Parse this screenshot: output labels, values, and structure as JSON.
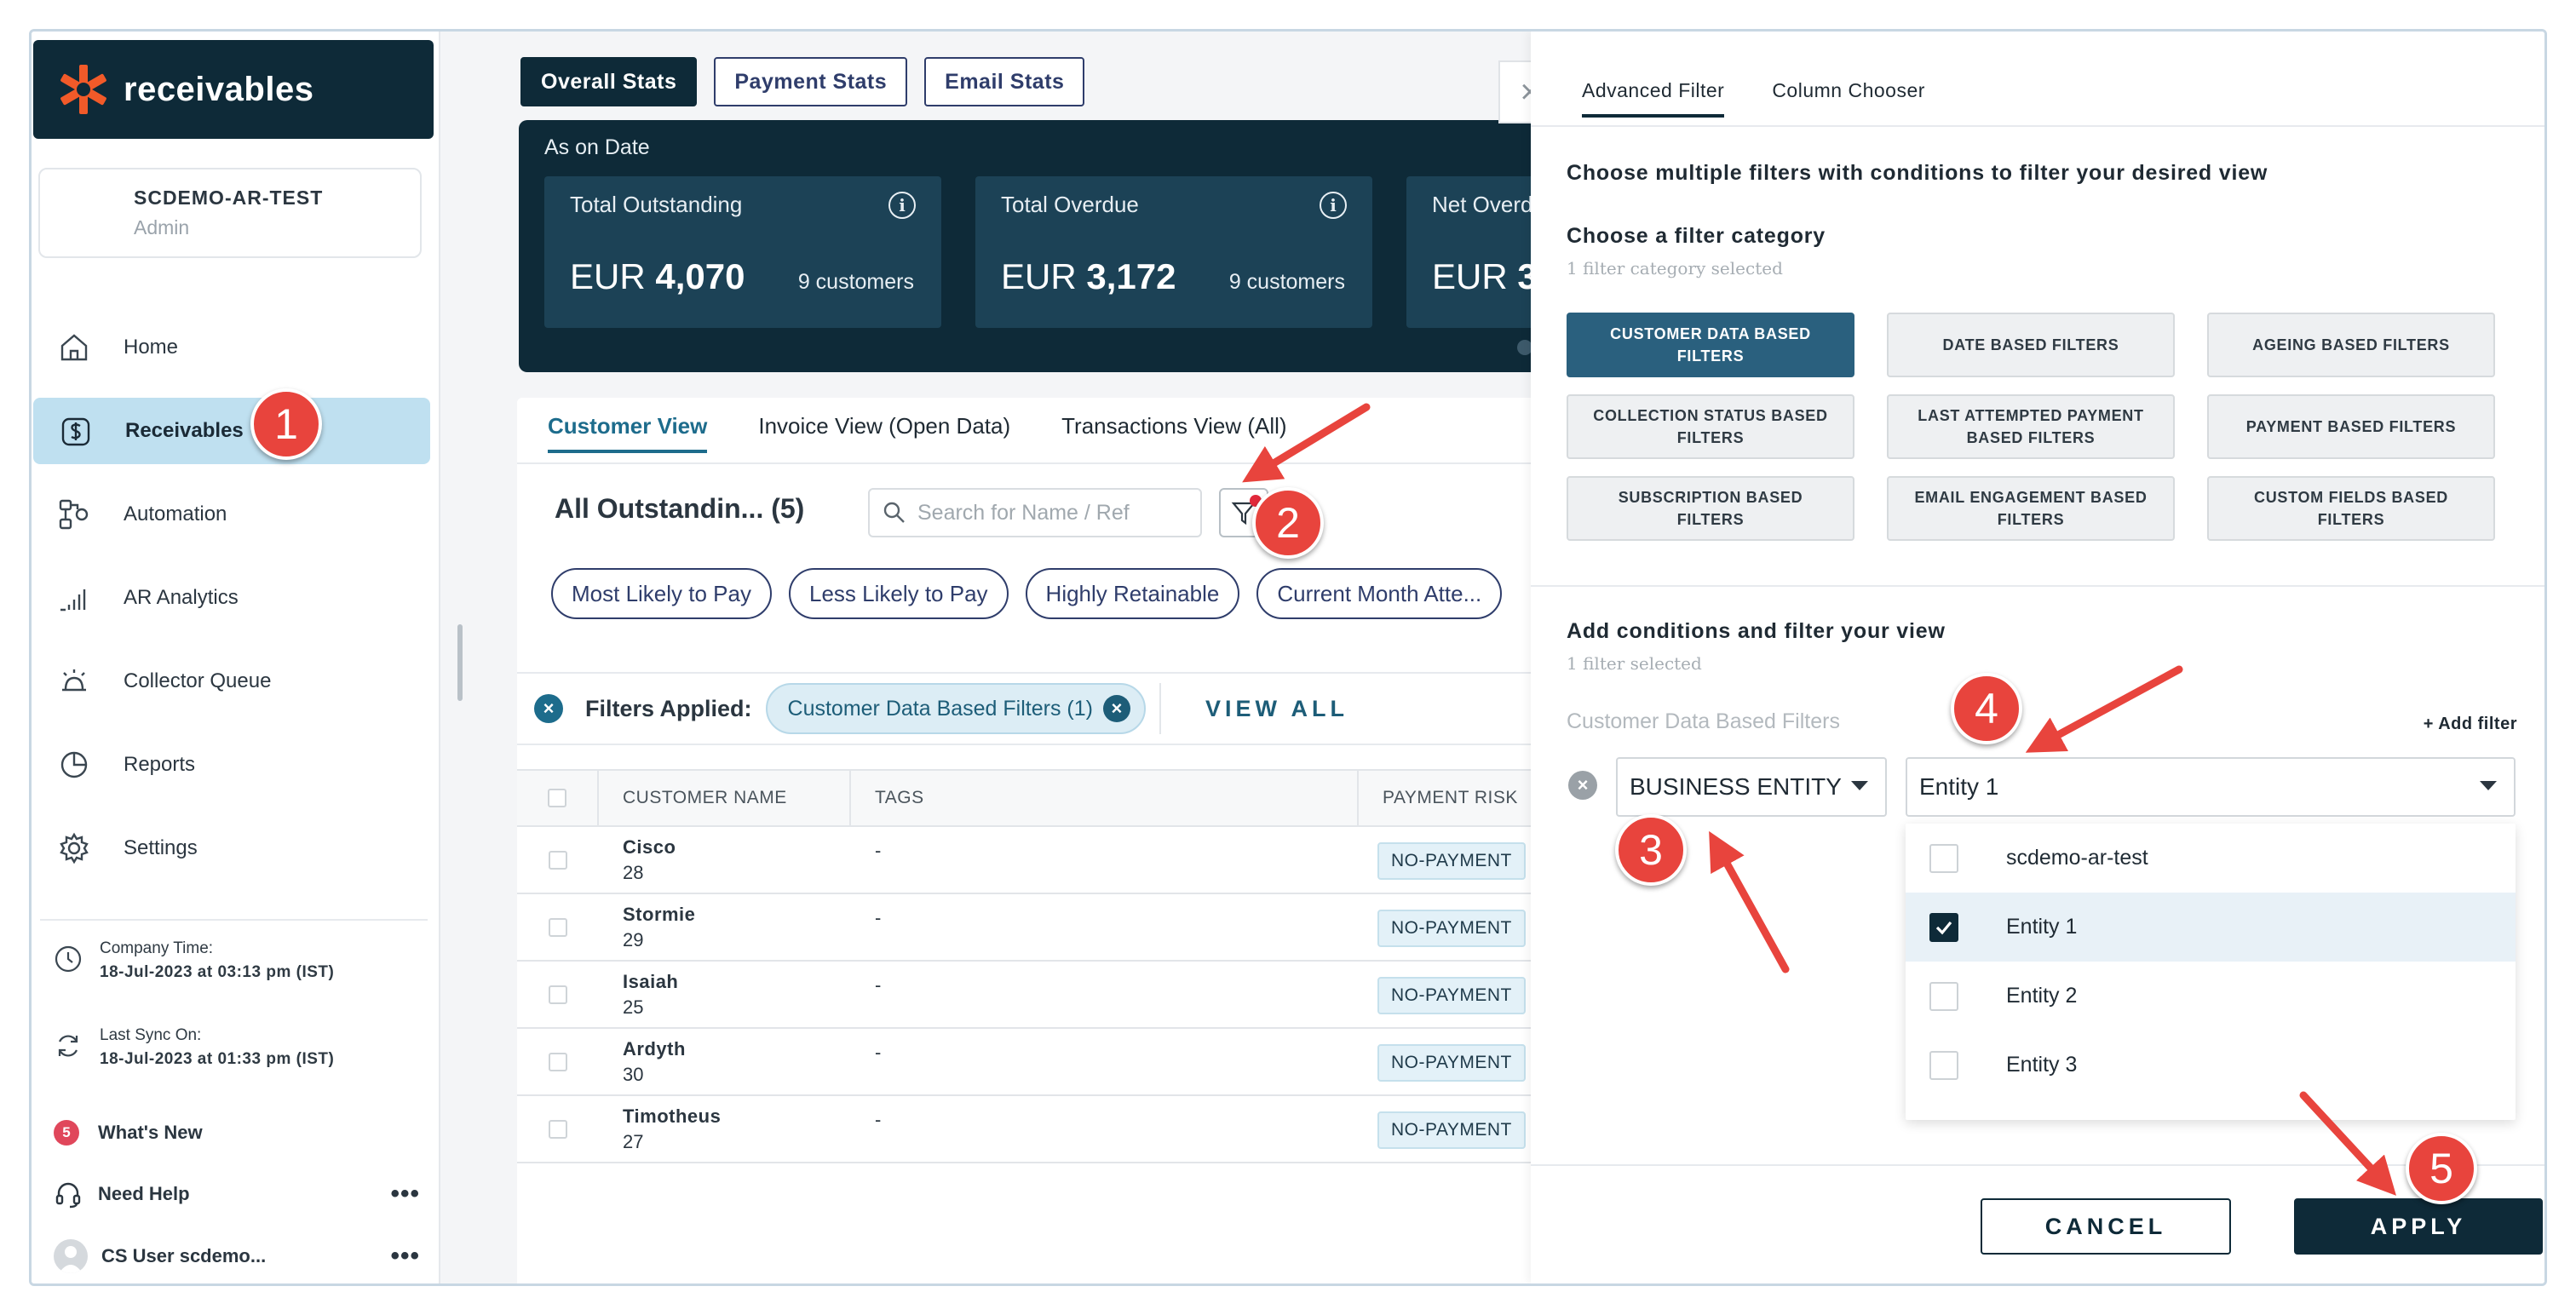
{
  "brand": {
    "name": "receivables",
    "accent": "#f15a29"
  },
  "org": {
    "name": "SCDEMO-AR-TEST",
    "role": "Admin"
  },
  "nav": [
    {
      "label": "Home",
      "icon": "home-icon"
    },
    {
      "label": "Receivables",
      "icon": "dollar-icon",
      "active": true
    },
    {
      "label": "Automation",
      "icon": "automation-icon"
    },
    {
      "label": "AR Analytics",
      "icon": "analytics-icon"
    },
    {
      "label": "Collector Queue",
      "icon": "bell-icon"
    },
    {
      "label": "Reports",
      "icon": "pie-chart-icon"
    },
    {
      "label": "Settings",
      "icon": "gear-icon"
    }
  ],
  "sidebar_meta": {
    "company_time_label": "Company Time:",
    "company_time_value": "18-Jul-2023 at 03:13 pm (IST)",
    "last_sync_label": "Last Sync On:",
    "last_sync_value": "18-Jul-2023 at 01:33 pm (IST)",
    "whats_new_count": "5",
    "whats_new_label": "What's New",
    "help_label": "Need Help",
    "user_label": "CS User scdemo...",
    "more": "•••"
  },
  "stats_tabs": [
    "Overall Stats",
    "Payment Stats",
    "Email Stats"
  ],
  "stats": {
    "caption": "As on Date",
    "cards": [
      {
        "title": "Total Outstanding",
        "currency": "EUR",
        "amount": "4,070",
        "customers": "9 customers"
      },
      {
        "title": "Total Overdue",
        "currency": "EUR",
        "amount": "3,172",
        "customers": "9 customers"
      },
      {
        "title": "Net Overd",
        "currency": "EUR",
        "amount": "3",
        "customers": ""
      }
    ]
  },
  "views": {
    "tabs": [
      "Customer View",
      "Invoice View (Open Data)",
      "Transactions View (All)"
    ]
  },
  "list": {
    "title": "All Outstandin... (5)",
    "search_placeholder": "Search for Name / Ref",
    "quick_chips": [
      "Most Likely to Pay",
      "Less Likely to Pay",
      "Highly Retainable",
      "Current Month Atte..."
    ],
    "filters_applied_label": "Filters Applied:",
    "applied_chip": "Customer Data Based Filters (1)",
    "view_all": "VIEW ALL"
  },
  "table": {
    "headers": [
      "CUSTOMER NAME",
      "TAGS",
      "PAYMENT RISK"
    ],
    "rows": [
      {
        "name": "Cisco",
        "days": "28",
        "tags": "-",
        "risk": "NO-PAYMENT"
      },
      {
        "name": "Stormie",
        "days": "29",
        "tags": "-",
        "risk": "NO-PAYMENT"
      },
      {
        "name": "Isaiah",
        "days": "25",
        "tags": "-",
        "risk": "NO-PAYMENT"
      },
      {
        "name": "Ardyth",
        "days": "30",
        "tags": "-",
        "risk": "NO-PAYMENT"
      },
      {
        "name": "Timotheus",
        "days": "27",
        "tags": "-",
        "risk": "NO-PAYMENT"
      }
    ]
  },
  "drawer": {
    "tabs": [
      "Advanced Filter",
      "Column Chooser"
    ],
    "intro": "Choose multiple filters with conditions to filter your desired view",
    "category_heading": "Choose a filter category",
    "category_sub": "1 filter category selected",
    "categories": [
      "CUSTOMER DATA BASED FILTERS",
      "DATE BASED FILTERS",
      "AGEING BASED FILTERS",
      "COLLECTION STATUS BASED FILTERS",
      "LAST ATTEMPTED PAYMENT BASED FILTERS",
      "PAYMENT BASED FILTERS",
      "SUBSCRIPTION BASED FILTERS",
      "EMAIL ENGAGEMENT BASED FILTERS",
      "CUSTOM FIELDS BASED FILTERS"
    ],
    "conditions_heading": "Add conditions and filter your view",
    "conditions_sub": "1 filter selected",
    "condition_group": "Customer Data Based Filters",
    "add_filter": "+ Add filter",
    "field_value": "BUSINESS ENTITY",
    "entity_value": "Entity 1",
    "options": [
      {
        "label": "scdemo-ar-test",
        "checked": false
      },
      {
        "label": "Entity 1",
        "checked": true
      },
      {
        "label": "Entity 2",
        "checked": false
      },
      {
        "label": "Entity 3",
        "checked": false
      }
    ],
    "cancel": "CANCEL",
    "apply": "APPLY"
  },
  "steps": [
    "1",
    "2",
    "3",
    "4",
    "5"
  ],
  "colors": {
    "navy": "#0e2a38",
    "teal": "#1d6c8c",
    "annotation_red": "#e8443d"
  }
}
